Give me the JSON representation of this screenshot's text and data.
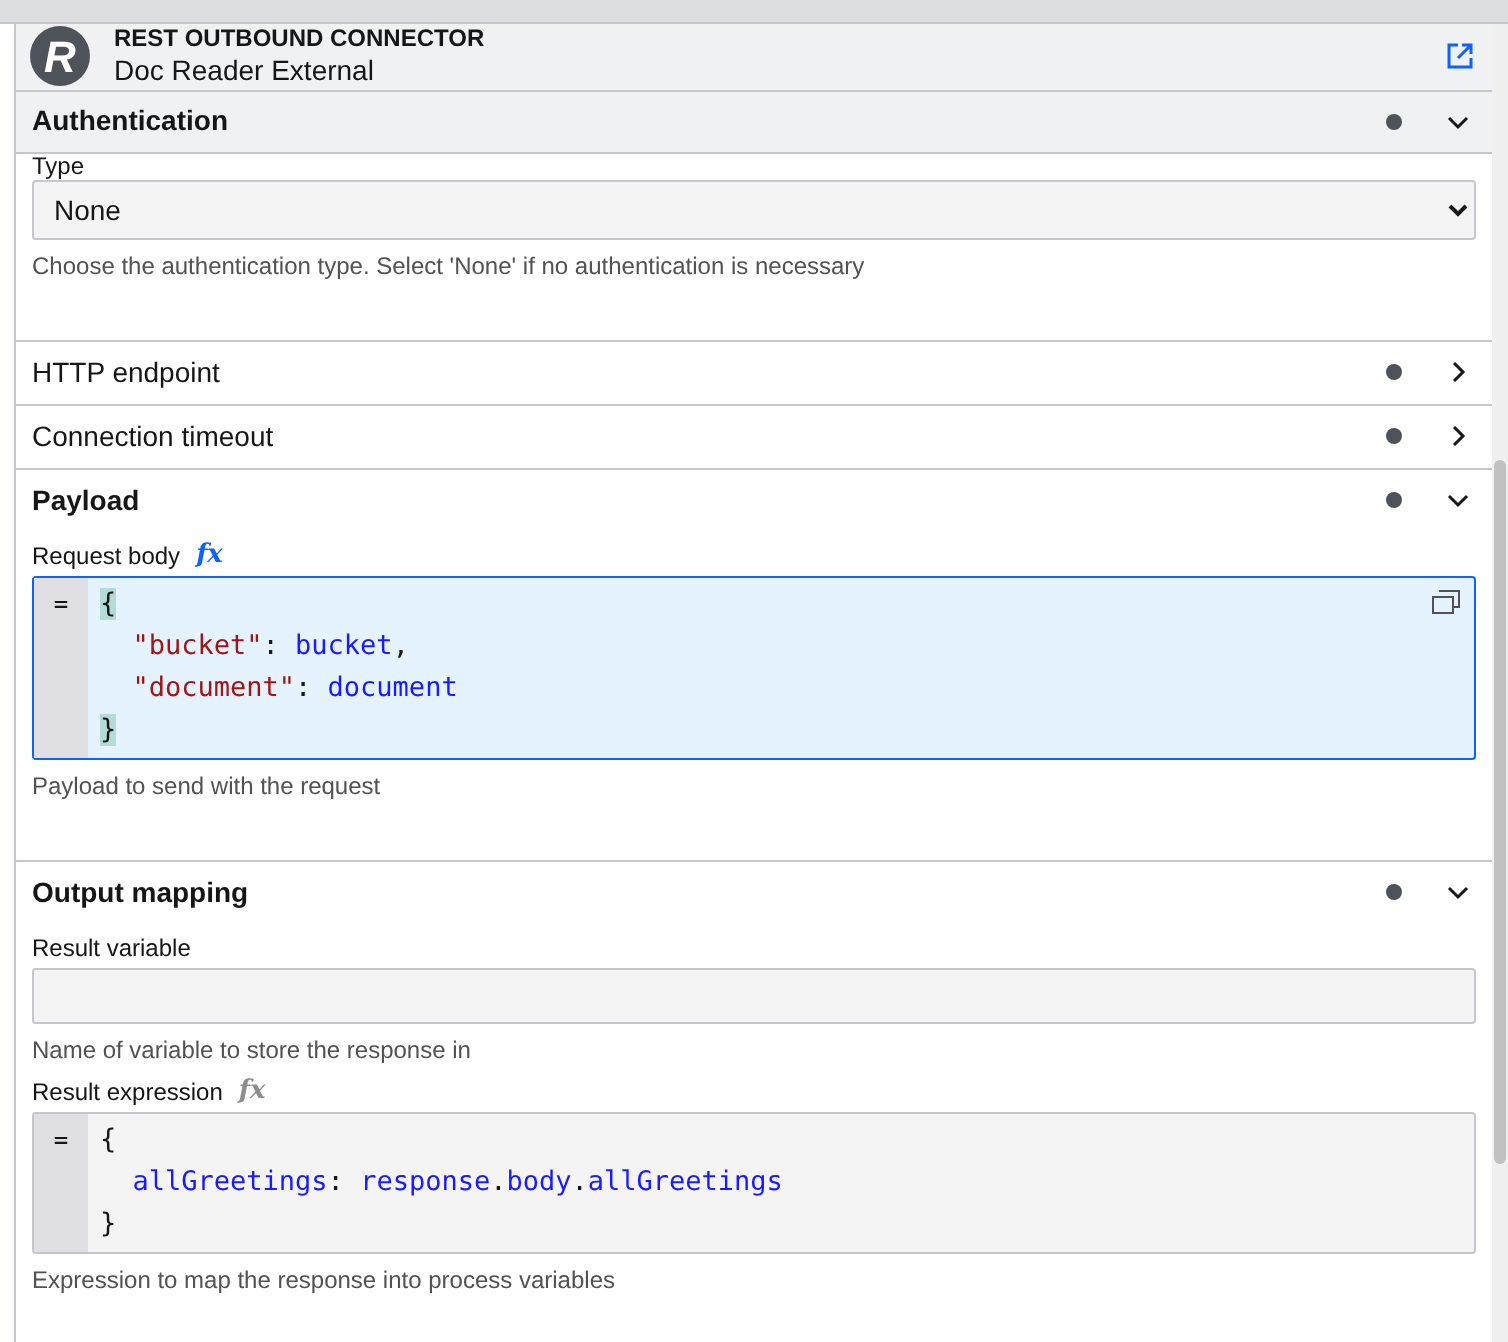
{
  "header": {
    "category": "REST OUTBOUND CONNECTOR",
    "name": "Doc Reader External",
    "logo_letter": "R"
  },
  "sections": [
    {
      "title": "Authentication",
      "expanded": true,
      "fields": [
        {
          "kind": "select",
          "label": "Type",
          "value": "None",
          "help": "Choose the authentication type. Select 'None' if no authentication is necessary"
        }
      ]
    },
    {
      "title": "HTTP endpoint",
      "expanded": false
    },
    {
      "title": "Connection timeout",
      "expanded": false
    },
    {
      "title": "Payload",
      "expanded": true,
      "fields": [
        {
          "kind": "code",
          "label": "Request body",
          "fx": "fx",
          "focused": true,
          "brackets_matched": true,
          "prefix": "=",
          "help": "Payload to send with the request",
          "lines": [
            [
              {
                "kind": "bracket",
                "s": "{"
              }
            ],
            [
              {
                "kind": "string",
                "s": "\"bucket\"",
                "indent": true
              },
              {
                "kind": "punct",
                "s": ": "
              },
              {
                "kind": "ident",
                "s": "bucket"
              },
              {
                "kind": "punct",
                "s": ","
              }
            ],
            [
              {
                "kind": "string",
                "s": "\"document\"",
                "indent": true
              },
              {
                "kind": "punct",
                "s": ": "
              },
              {
                "kind": "ident",
                "s": "document"
              }
            ],
            [
              {
                "kind": "bracket",
                "s": "}"
              }
            ]
          ]
        }
      ]
    },
    {
      "title": "Output mapping",
      "expanded": true,
      "fields": [
        {
          "kind": "text",
          "label": "Result variable",
          "help": "Name of variable to store the response in"
        },
        {
          "kind": "code",
          "label": "Result expression",
          "fx": "fx",
          "focused": false,
          "brackets_matched": false,
          "prefix": "=",
          "help": "Expression to map the response into process variables",
          "lines": [
            [
              {
                "kind": "bracket",
                "s": "{"
              }
            ],
            [
              {
                "kind": "ident",
                "s": "allGreetings",
                "indent": true
              },
              {
                "kind": "punct",
                "s": ": "
              },
              {
                "kind": "ident",
                "s": "response"
              },
              {
                "kind": "punct",
                "s": "."
              },
              {
                "kind": "ident",
                "s": "body"
              },
              {
                "kind": "punct",
                "s": "."
              },
              {
                "kind": "ident",
                "s": "allGreetings"
              }
            ],
            [
              {
                "kind": "bracket",
                "s": "}"
              }
            ]
          ]
        }
      ]
    }
  ]
}
